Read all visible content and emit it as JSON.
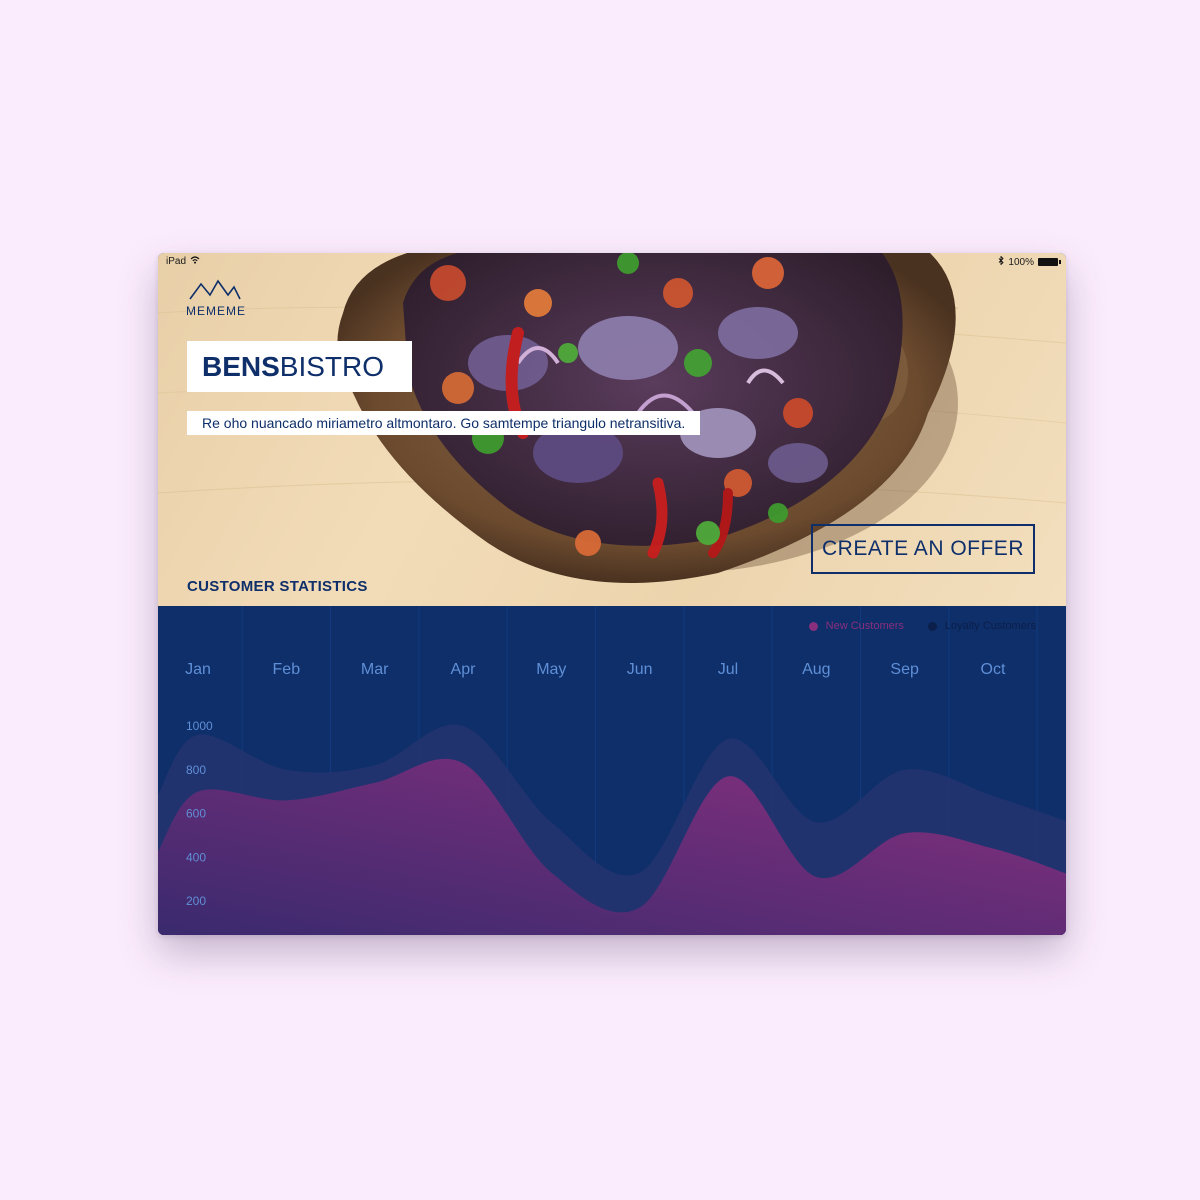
{
  "status_bar": {
    "device": "iPad",
    "battery": "100%"
  },
  "brand": {
    "logo_text": "MEMEME"
  },
  "hero": {
    "title_bold": "BENS",
    "title_light": "BISTRO",
    "tagline": "Re oho nuancado miriametro altmontaro. Go samtempe triangulo netransitiva.",
    "cta_label": "CREATE AN OFFER"
  },
  "stats": {
    "section_title": "CUSTOMER STATISTICS"
  },
  "colors": {
    "navy": "#0e2f6a",
    "new_customers": "#8a2f7e",
    "loyalty_customers": "#0b1f4a",
    "axis_text": "#5f8fd6"
  },
  "chart_data": {
    "type": "area",
    "categories": [
      "Jan",
      "Feb",
      "Mar",
      "Apr",
      "May",
      "Jun",
      "Jul",
      "Aug",
      "Sep",
      "Oct"
    ],
    "y_ticks": [
      1000,
      800,
      600,
      400,
      200
    ],
    "series": [
      {
        "name": "Loyalty Customers",
        "values": [
          960,
          800,
          820,
          1000,
          560,
          330,
          940,
          560,
          800,
          680
        ]
      },
      {
        "name": "New Customers",
        "values": [
          700,
          660,
          740,
          830,
          330,
          170,
          770,
          310,
          510,
          440
        ]
      }
    ],
    "legend_position": "top-right"
  }
}
